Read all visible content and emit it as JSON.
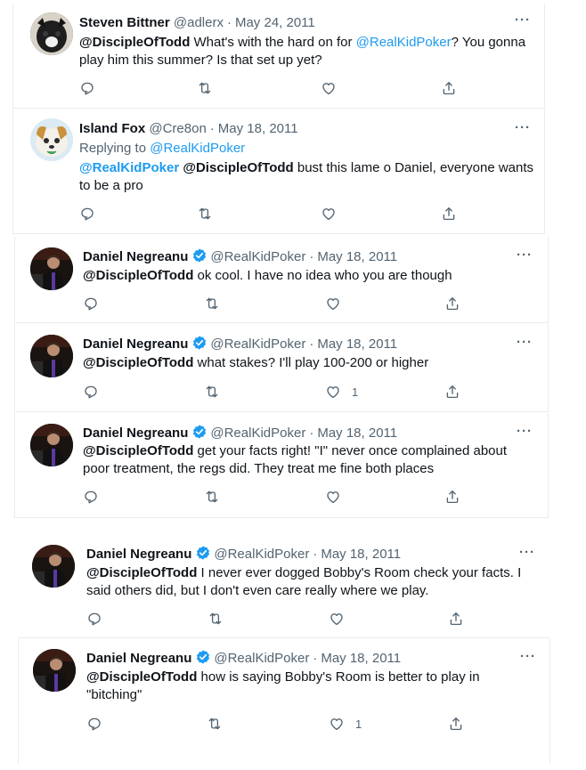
{
  "tweets": [
    {
      "name": "Steven Bittner",
      "handle": "@adlerx",
      "dot": "·",
      "date": "May 24, 2011",
      "more": "···",
      "reply_prefix": "",
      "reply_handle": "",
      "segments": [
        {
          "text": "@DiscipleOfTodd",
          "style": "bold"
        },
        {
          "text": " What's with the hard on for ",
          "style": "plain"
        },
        {
          "text": "@RealKidPoker",
          "style": "link"
        },
        {
          "text": "? You gonna play him this summer? Is that set up yet?",
          "style": "plain"
        }
      ],
      "like_count": "",
      "avatar": "steven"
    },
    {
      "name": "Island Fox",
      "handle": "@Cre8on",
      "dot": "·",
      "date": "May 18, 2011",
      "more": "···",
      "reply_prefix": "Replying to ",
      "reply_handle": "@RealKidPoker",
      "segments": [
        {
          "text": "@RealKidPoker",
          "style": "link-bold"
        },
        {
          "text": " ",
          "style": "plain"
        },
        {
          "text": "@DiscipleOfTodd",
          "style": "bold"
        },
        {
          "text": " bust this lame o Daniel, everyone wants to be a pro",
          "style": "plain"
        }
      ],
      "like_count": "",
      "avatar": "island"
    },
    {
      "name": "Daniel Negreanu",
      "handle": "@RealKidPoker",
      "dot": "·",
      "date": "May 18, 2011",
      "more": "···",
      "reply_prefix": "",
      "reply_handle": "",
      "segments": [
        {
          "text": "@DiscipleOfTodd",
          "style": "bold"
        },
        {
          "text": " ok cool. I have no idea who you are though",
          "style": "plain"
        }
      ],
      "like_count": "",
      "avatar": "daniel"
    },
    {
      "name": "Daniel Negreanu",
      "handle": "@RealKidPoker",
      "dot": "·",
      "date": "May 18, 2011",
      "more": "···",
      "reply_prefix": "",
      "reply_handle": "",
      "segments": [
        {
          "text": "@DiscipleOfTodd",
          "style": "bold"
        },
        {
          "text": " what stakes? I'll play 100-200 or higher",
          "style": "plain"
        }
      ],
      "like_count": "1",
      "avatar": "daniel"
    },
    {
      "name": "Daniel Negreanu",
      "handle": "@RealKidPoker",
      "dot": "·",
      "date": "May 18, 2011",
      "more": "···",
      "reply_prefix": "",
      "reply_handle": "",
      "segments": [
        {
          "text": "@DiscipleOfTodd",
          "style": "bold"
        },
        {
          "text": " get your facts right! \"I\" never once complained about poor treatment, the regs did. They treat me fine both places",
          "style": "plain"
        }
      ],
      "like_count": "",
      "avatar": "daniel"
    },
    {
      "name": "Daniel Negreanu",
      "handle": "@RealKidPoker",
      "dot": "·",
      "date": "May 18, 2011",
      "more": "···",
      "reply_prefix": "",
      "reply_handle": "",
      "segments": [
        {
          "text": "@DiscipleOfTodd",
          "style": "bold"
        },
        {
          "text": " I never ever dogged Bobby's Room check your facts. I said others did, but I don't even care really where we play.",
          "style": "plain"
        }
      ],
      "like_count": "",
      "avatar": "daniel"
    },
    {
      "name": "Daniel Negreanu",
      "handle": "@RealKidPoker",
      "dot": "·",
      "date": "May 18, 2011",
      "more": "···",
      "reply_prefix": "",
      "reply_handle": "",
      "segments": [
        {
          "text": "@DiscipleOfTodd",
          "style": "bold"
        },
        {
          "text": " how is saying Bobby's Room is better to play in \"bitching\"",
          "style": "plain"
        }
      ],
      "like_count": "1",
      "avatar": "daniel"
    }
  ],
  "icons": {
    "reply": "reply-icon",
    "retweet": "retweet-icon",
    "like": "like-icon",
    "share": "share-icon",
    "verified": "verified-badge-icon"
  },
  "colors": {
    "link": "#1d9bf0",
    "muted": "#536471",
    "verified": "#1d9bf0"
  }
}
